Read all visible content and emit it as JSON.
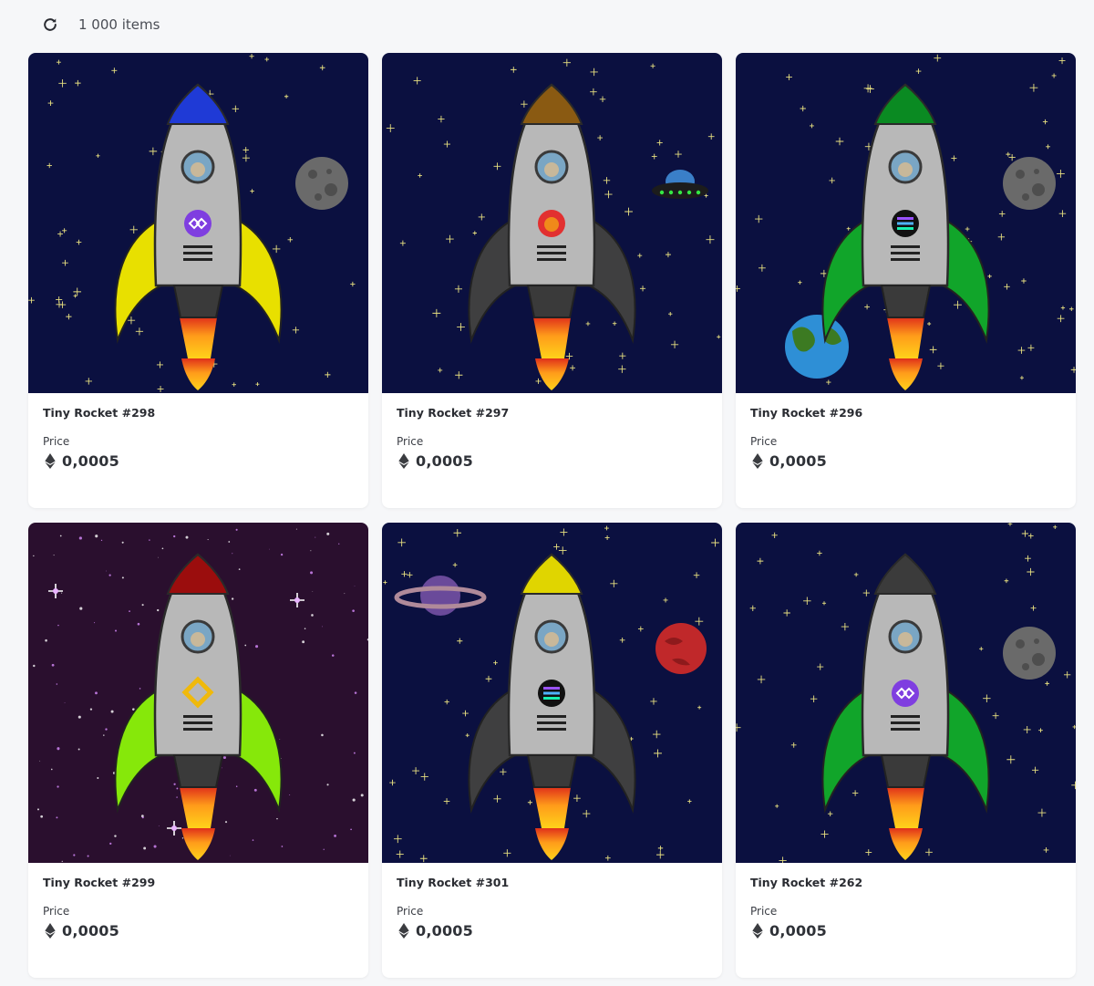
{
  "header": {
    "refresh_icon": "refresh-icon",
    "item_count": "1 000 items"
  },
  "cards": [
    {
      "name": "Tiny Rocket #298",
      "price_label": "Price",
      "price": "0,0005",
      "currency_icon": "ethereum-icon",
      "background": "space-blue",
      "nose_color": "#1f3ad6",
      "fin_color": "#e8e000",
      "badge": "polygon",
      "extra": "moon"
    },
    {
      "name": "Tiny Rocket #297",
      "price_label": "Price",
      "price": "0,0005",
      "currency_icon": "ethereum-icon",
      "background": "space-blue",
      "nose_color": "#8a5a12",
      "fin_color": "#3f3f40",
      "badge": "shiba",
      "extra": "ufo"
    },
    {
      "name": "Tiny Rocket #296",
      "price_label": "Price",
      "price": "0,0005",
      "currency_icon": "ethereum-icon",
      "background": "space-blue",
      "nose_color": "#0a8a22",
      "fin_color": "#11a52a",
      "badge": "solana",
      "extra": "moon-earth"
    },
    {
      "name": "Tiny Rocket #299",
      "price_label": "Price",
      "price": "0,0005",
      "currency_icon": "ethereum-icon",
      "background": "space-purple",
      "nose_color": "#9b0d0d",
      "fin_color": "#86e80a",
      "badge": "binance",
      "extra": "none"
    },
    {
      "name": "Tiny Rocket #301",
      "price_label": "Price",
      "price": "0,0005",
      "currency_icon": "ethereum-icon",
      "background": "space-blue",
      "nose_color": "#e0d500",
      "fin_color": "#3f3f40",
      "badge": "solana",
      "extra": "saturn-mars"
    },
    {
      "name": "Tiny Rocket #262",
      "price_label": "Price",
      "price": "0,0005",
      "currency_icon": "ethereum-icon",
      "background": "space-blue",
      "nose_color": "#3b3b3b",
      "fin_color": "#11a52a",
      "badge": "polygon",
      "extra": "moon"
    }
  ]
}
